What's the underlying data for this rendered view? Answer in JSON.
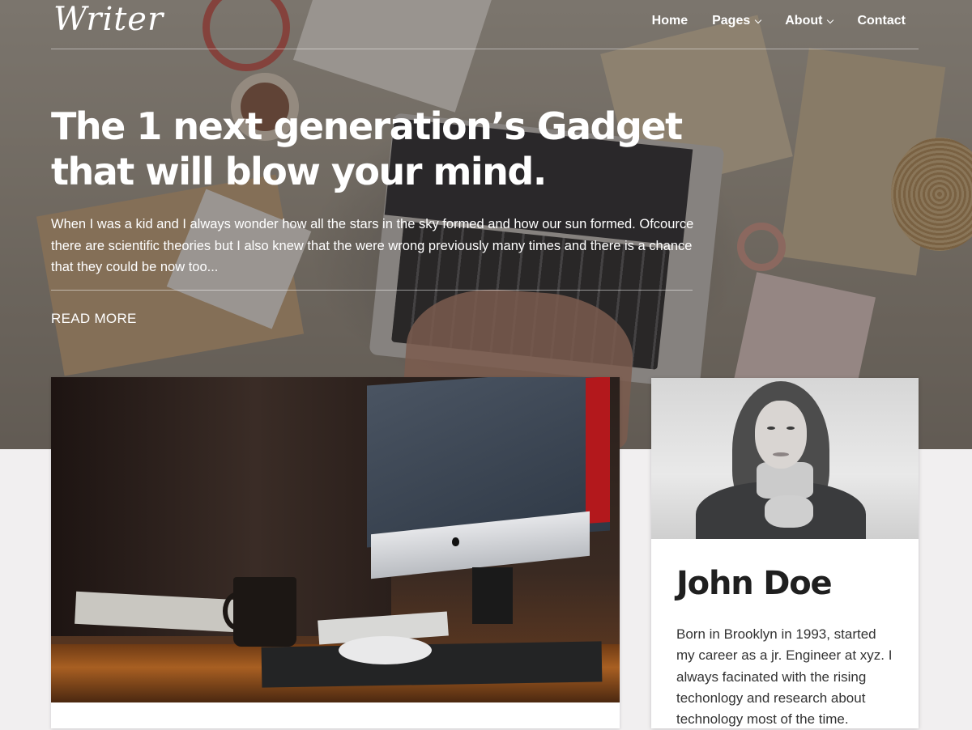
{
  "header": {
    "logo": "Writer",
    "nav": [
      {
        "label": "Home",
        "has_dropdown": false
      },
      {
        "label": "Pages",
        "has_dropdown": true
      },
      {
        "label": "About",
        "has_dropdown": true
      },
      {
        "label": "Contact",
        "has_dropdown": false
      }
    ]
  },
  "hero": {
    "title": "The 1 next generation’s Gadget that will blow your mind.",
    "excerpt": "When I was a kid and I always wonder how all the stars in the sky formed and how our sun formed. Ofcource there are scientific theories but I also knew that the were wrong previously many times and there is a chance that they could be now too...",
    "read_more": "READ MORE"
  },
  "author": {
    "name": "John Doe",
    "bio": "Born in Brooklyn in 1993, started my career as a jr. Engineer at xyz. I always facinated with the rising techonlogy and research about technology most of the time."
  },
  "icons": {
    "dropdown": "chevron-down-icon"
  },
  "colors": {
    "text_on_hero": "#ffffff",
    "page_background": "#f1eff0",
    "card_background": "#ffffff",
    "heading_dark": "#1f1f1f"
  }
}
